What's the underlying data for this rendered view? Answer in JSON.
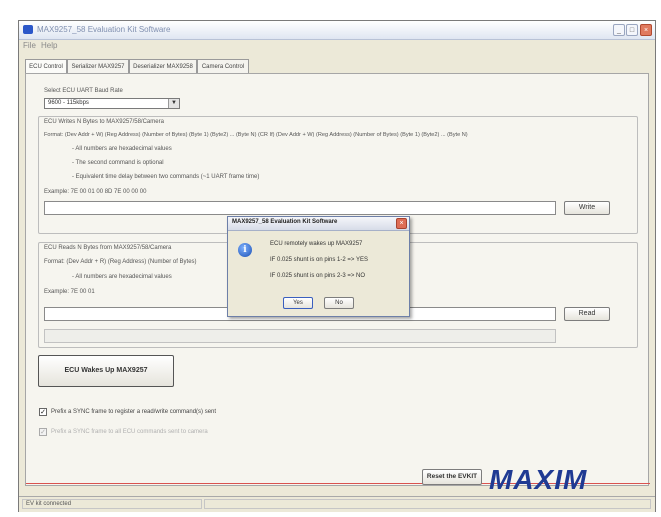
{
  "window": {
    "title": "MAX9257_58 Evaluation Kit Software",
    "min_label": "_",
    "max_label": "□",
    "close_label": "×"
  },
  "menu": [
    "File",
    "Help"
  ],
  "tabs": [
    {
      "label": "ECU Control"
    },
    {
      "label": "Serializer MAX9257"
    },
    {
      "label": "Deserializer MAX9258"
    },
    {
      "label": "Camera Control"
    }
  ],
  "baud": {
    "label": "Select ECU UART Baud Rate",
    "value": "9600 - 115kbps"
  },
  "write_group": {
    "heading": "ECU Writes N Bytes to MAX9257/58/Camera",
    "format": "Format: (Dev Addr + W) (Reg Address) (Number of Bytes) (Byte 1) (Byte2) ... (Byte N) (CR If) (Dev Addr + W) (Reg Address) (Number of Bytes) (Byte 1) (Byte2) ... (Byte N)",
    "notes": [
      "- All numbers are hexadecimal values",
      "- The second command is optional",
      "- Equivalent time delay between two commands (~1 UART frame time)"
    ],
    "example": "Example: 7E 00 01 00 8D 7E 00 00 00",
    "input_value": "",
    "button_label": "Write"
  },
  "read_group": {
    "heading": "ECU Reads N Bytes from MAX9257/58/Camera",
    "format": "Format: (Dev Addr + R) (Reg Address) (Number of Bytes)",
    "notes": [
      "- All numbers are hexadecimal values"
    ],
    "example": "Example: 7E 00 01",
    "input_value": "",
    "output_value": "",
    "button_label": "Read"
  },
  "wake_button_label": "ECU Wakes Up MAX9257",
  "checkboxes": [
    {
      "label": "Prefix a SYNC frame to register a read/write command(s) sent",
      "checked": true,
      "enabled": true
    },
    {
      "label": "Prefix a SYNC frame to all ECU commands sent to camera",
      "checked": true,
      "enabled": false
    }
  ],
  "reset_button_label": "Reset the EVKIT",
  "logo_text": "MAXIM",
  "status": {
    "text": "EV kit connected"
  },
  "dialog": {
    "title": "MAX9257_58 Evaluation Kit Software",
    "close_label": "×",
    "icon": "info-icon",
    "lines": [
      "ECU remotely wakes up MAX9257",
      "IF 0.025 shunt is on pins 1-2 => YES",
      "IF 0.025 shunt is on pins 2-3 => NO"
    ],
    "yes_label": "Yes",
    "no_label": "No"
  },
  "colors": {
    "accent": "#1f3a93",
    "separator": "#d9534f",
    "title_icon": "#2b57c9",
    "window_bg": "#ece9d8"
  }
}
